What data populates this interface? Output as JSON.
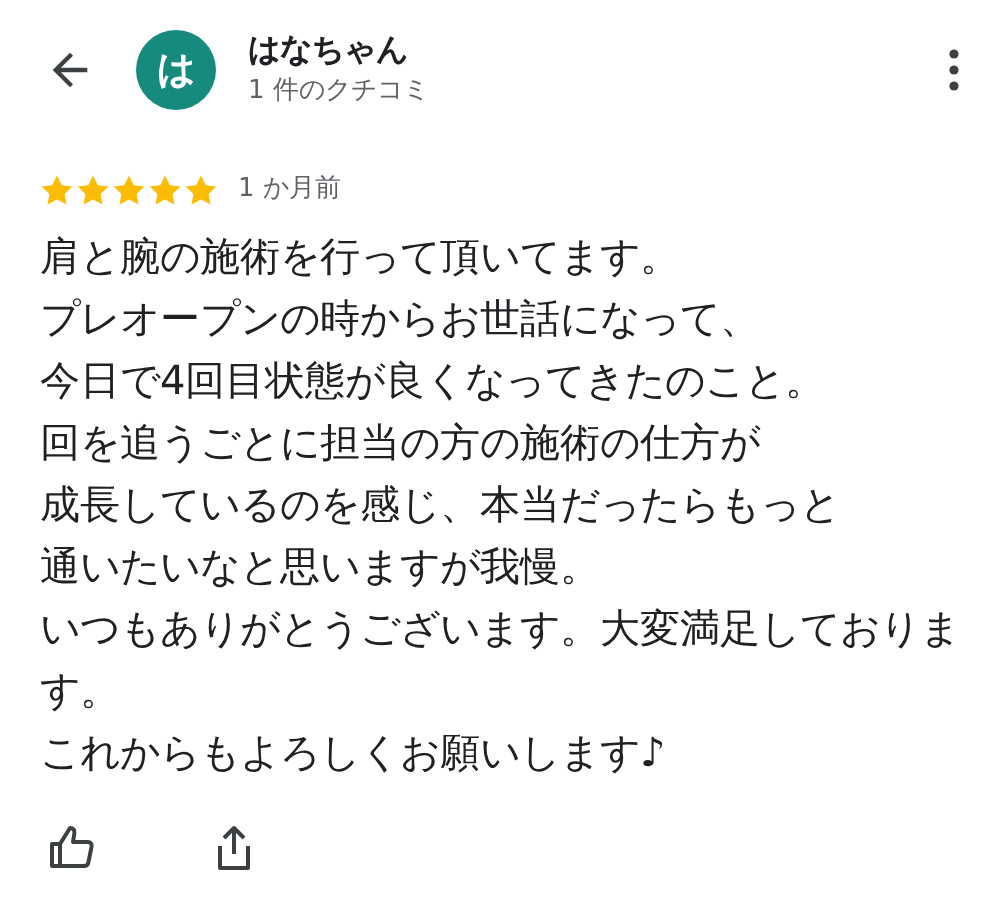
{
  "reviewer": {
    "avatar_letter": "は",
    "name": "はなちゃん",
    "review_count": "1 件のクチコミ"
  },
  "review": {
    "stars": 5,
    "time": "1 か月前",
    "lines": [
      "肩と腕の施術を行って頂いてます。",
      "プレオープンの時からお世話になって、",
      "今日で4回目状態が良くなってきたのこと。",
      "回を追うごとに担当の方の施術の仕方が",
      "成長しているのを感じ、本当だったらもっと",
      "通いたいなと思いますが我慢。",
      "いつもありがとうございます。大変満足しております。",
      "これからもよろしくお願いします♪"
    ]
  }
}
